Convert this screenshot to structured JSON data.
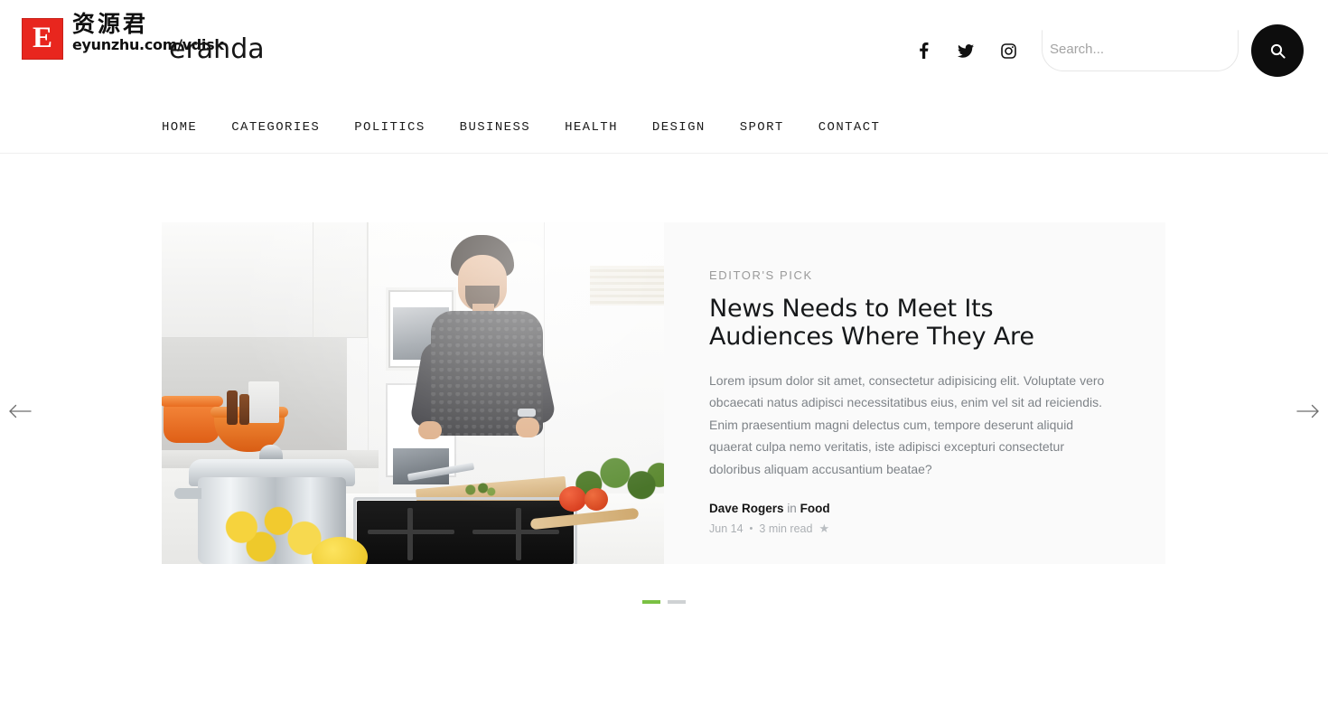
{
  "brand": {
    "mark_letter": "E",
    "cn_name": "资源君",
    "url": "eyunzhu.com/vdisk",
    "wordmark": "eranda"
  },
  "header": {
    "social": [
      {
        "name": "facebook-icon",
        "label": "Facebook"
      },
      {
        "name": "twitter-icon",
        "label": "Twitter"
      },
      {
        "name": "instagram-icon",
        "label": "Instagram"
      }
    ],
    "search": {
      "placeholder": "Search...",
      "value": "",
      "button_icon": "search-icon"
    }
  },
  "nav": {
    "items": [
      {
        "label": "HOME"
      },
      {
        "label": "CATEGORIES"
      },
      {
        "label": "POLITICS"
      },
      {
        "label": "BUSINESS"
      },
      {
        "label": "HEALTH"
      },
      {
        "label": "DESIGN"
      },
      {
        "label": "SPORT"
      },
      {
        "label": "CONTACT"
      }
    ]
  },
  "hero": {
    "kicker": "EDITOR'S PICK",
    "title": "News Needs to Meet Its Audiences Where They Are",
    "excerpt": "Lorem ipsum dolor sit amet, consectetur adipisicing elit. Voluptate vero obcaecati natus adipisci necessitatibus eius, enim vel sit ad reiciendis. Enim praesentium magni delectus cum, tempore deserunt aliquid quaerat culpa nemo veritatis, iste adipisci excepturi consectetur doloribus aliquam accusantium beatae?",
    "author": "Dave Rogers",
    "in_word": "in",
    "category": "Food",
    "date": "Jun 14",
    "separator": "•",
    "read_time": "3 min read",
    "featured_icon": "★",
    "image_alt": "Man cooking in a modern white kitchen",
    "prev_icon": "arrow-left-icon",
    "next_icon": "arrow-right-icon",
    "slides": [
      {
        "active": true
      },
      {
        "active": false
      }
    ]
  },
  "colors": {
    "brand_red": "#e8261e",
    "accent_green": "#7ac143",
    "dot_inactive": "#cfd2d4",
    "card_bg": "#fafafa",
    "text_dark": "#16181a",
    "text_muted": "#7e8388"
  }
}
